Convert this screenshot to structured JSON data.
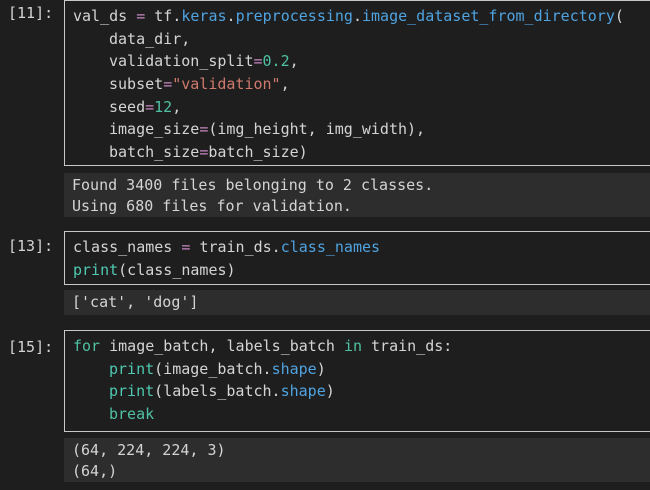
{
  "cells": [
    {
      "prompt": "[11]:",
      "code": {
        "l1_var": "val_ds",
        "l1_eq": " = ",
        "l1_tf": "tf.",
        "l1_mod": "keras",
        "l1_dot1": ".",
        "l1_mod2": "preprocessing",
        "l1_dot2": ".",
        "l1_fn": "image_dataset_from_directory",
        "l1_paren": "(",
        "l2": "data_dir,",
        "l3_a": "validation_split",
        "l3_eq": "=",
        "l3_v": "0.2",
        "l3_c": ",",
        "l4_a": "subset",
        "l4_eq": "=",
        "l4_v": "\"validation\"",
        "l4_c": ",",
        "l5_a": "seed",
        "l5_eq": "=",
        "l5_v": "12",
        "l5_c": ",",
        "l6_a": "image_size",
        "l6_eq": "=",
        "l6_v": "(img_height, img_width),",
        "l7_a": "batch_size",
        "l7_eq": "=",
        "l7_v": "batch_size)"
      },
      "output": [
        "Found 3400 files belonging to 2 classes.",
        "Using 680 files for validation."
      ]
    },
    {
      "prompt": "[13]:",
      "code": {
        "l1_a": "class_names",
        "l1_eq": " = ",
        "l1_b": "train_ds.",
        "l1_attr": "class_names",
        "l2_fn": "print",
        "l2_rest": "(class_names)"
      },
      "output": [
        "['cat', 'dog']"
      ]
    },
    {
      "prompt": "[15]:",
      "code": {
        "l1_for": "for",
        "l1_mid": " image_batch, labels_batch ",
        "l1_in": "in",
        "l1_end": " train_ds:",
        "l2_fn": "print",
        "l2_a": "(image_batch.",
        "l2_attr": "shape",
        "l2_b": ")",
        "l3_fn": "print",
        "l3_a": "(labels_batch.",
        "l3_attr": "shape",
        "l3_b": ")",
        "l4_kw": "break"
      },
      "output": [
        "(64, 224, 224, 3)",
        "(64,)"
      ]
    }
  ],
  "colors": {
    "background": "#1e1e1e",
    "output_background": "#2d2d2d",
    "cell_border": "#c8c8c8",
    "keyword": "#c586c0",
    "function": "#4fa3e0",
    "string": "#ce7a6d",
    "number": "#4fc1a3"
  }
}
